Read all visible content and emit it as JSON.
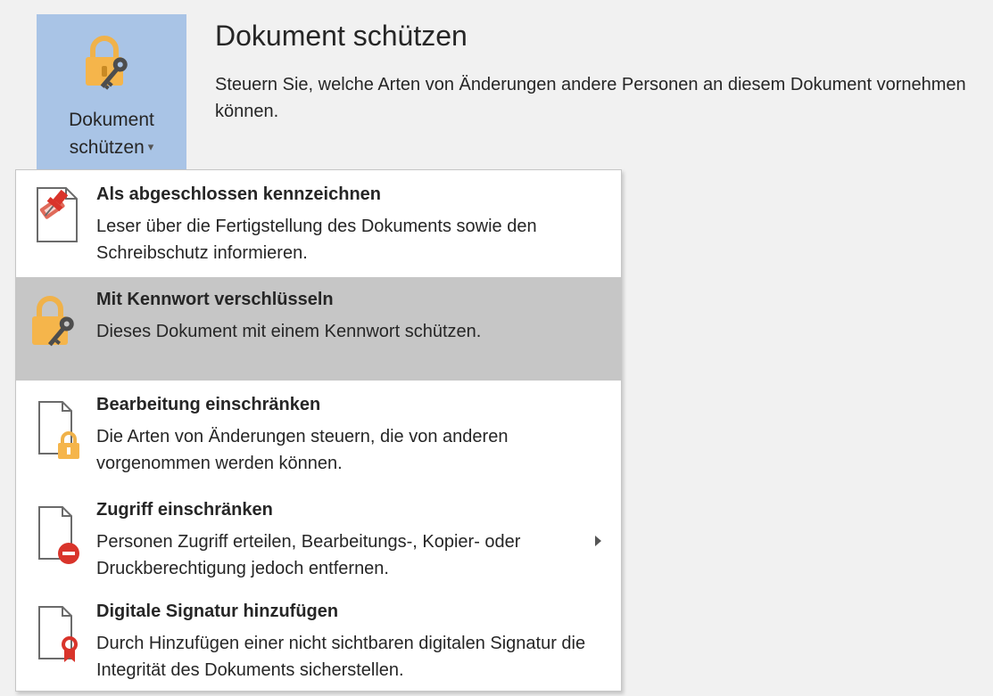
{
  "ribbon_button": {
    "label_line1": "Dokument",
    "label_line2": "schützen",
    "caret": "▾",
    "icon": "lock-key-icon"
  },
  "section": {
    "title": "Dokument schützen",
    "description": "Steuern Sie, welche Arten von Änderungen andere Personen an diesem Dokument vornehmen können."
  },
  "menu": {
    "items": [
      {
        "title": "Als abgeschlossen kennzeichnen",
        "description": "Leser über die Fertigstellung des Dokuments sowie den Schreibschutz informieren.",
        "icon": "mark-final-icon",
        "highlighted": false,
        "has_submenu": false
      },
      {
        "title": "Mit Kennwort verschlüsseln",
        "description": "Dieses Dokument mit einem Kennwort schützen.",
        "icon": "lock-key-icon",
        "highlighted": true,
        "has_submenu": false
      },
      {
        "title": "Bearbeitung einschränken",
        "description": "Die Arten von Änderungen steuern, die von anderen vorgenommen werden können.",
        "icon": "document-lock-icon",
        "highlighted": false,
        "has_submenu": false
      },
      {
        "title": "Zugriff einschränken",
        "description": "Personen Zugriff erteilen, Bearbeitungs-, Kopier- oder Druckberechtigung jedoch entfernen.",
        "icon": "document-restrict-icon",
        "highlighted": false,
        "has_submenu": true
      },
      {
        "title": "Digitale Signatur hinzufügen",
        "description": "Durch Hinzufügen einer nicht sichtbaren digitalen Signatur die Integrität des Dokuments sicherstellen.",
        "icon": "document-ribbon-icon",
        "highlighted": false,
        "has_submenu": false
      }
    ]
  },
  "colors": {
    "background": "#f1f1f1",
    "ribbon_button_active": "#a9c4e6",
    "menu_highlight": "#c6c6c6",
    "lock_orange": "#f5b54b",
    "restrict_red": "#d9342b"
  }
}
